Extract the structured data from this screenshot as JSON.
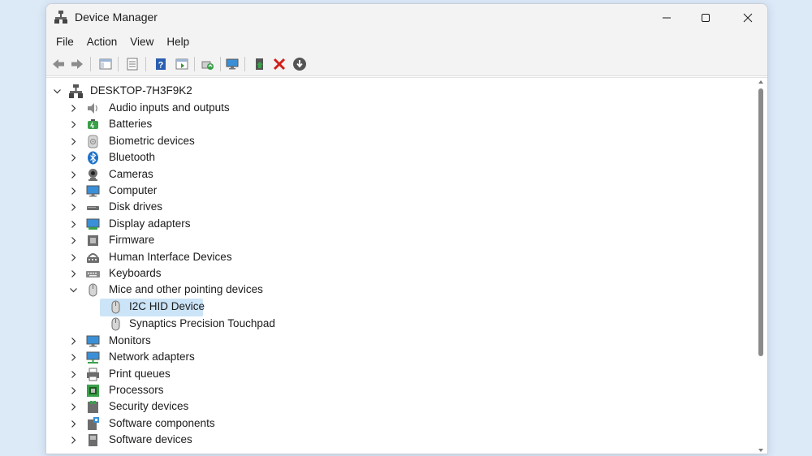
{
  "window": {
    "title": "Device Manager"
  },
  "menu": [
    "File",
    "Action",
    "View",
    "Help"
  ],
  "toolbar": {
    "buttons": [
      "back-arrow-icon",
      "forward-arrow-icon",
      "show-hide-tree-icon",
      "properties-icon",
      "help-icon",
      "action-pane-icon",
      "scan-hardware-icon",
      "computer-monitor-icon",
      "update-driver-icon",
      "uninstall-icon",
      "disable-device-icon"
    ]
  },
  "tree": {
    "root": "DESKTOP-7H3F9K2",
    "categories": [
      {
        "label": "Audio inputs and outputs",
        "icon": "speaker-icon"
      },
      {
        "label": "Batteries",
        "icon": "battery-icon"
      },
      {
        "label": "Biometric devices",
        "icon": "fingerprint-icon"
      },
      {
        "label": "Bluetooth",
        "icon": "bluetooth-icon"
      },
      {
        "label": "Cameras",
        "icon": "camera-icon"
      },
      {
        "label": "Computer",
        "icon": "computer-icon"
      },
      {
        "label": "Disk drives",
        "icon": "disk-drive-icon"
      },
      {
        "label": "Display adapters",
        "icon": "display-adapter-icon"
      },
      {
        "label": "Firmware",
        "icon": "firmware-icon"
      },
      {
        "label": "Human Interface Devices",
        "icon": "hid-icon"
      },
      {
        "label": "Keyboards",
        "icon": "keyboard-icon"
      },
      {
        "label": "Mice and other pointing devices",
        "icon": "mouse-icon"
      },
      {
        "label": "Monitors",
        "icon": "monitor-icon"
      },
      {
        "label": "Network adapters",
        "icon": "network-icon"
      },
      {
        "label": "Print queues",
        "icon": "printer-icon"
      },
      {
        "label": "Processors",
        "icon": "processor-icon"
      },
      {
        "label": "Security devices",
        "icon": "security-icon"
      },
      {
        "label": "Software components",
        "icon": "software-component-icon"
      },
      {
        "label": "Software devices",
        "icon": "software-device-icon"
      }
    ],
    "mice_children": [
      {
        "label": "I2C HID Device",
        "selected": true
      },
      {
        "label": "Synaptics Precision Touchpad",
        "selected": false
      }
    ]
  },
  "colors": {
    "selection": "#cce4f7",
    "accent_blue": "#1e73c8",
    "delete_red": "#d0201a"
  }
}
